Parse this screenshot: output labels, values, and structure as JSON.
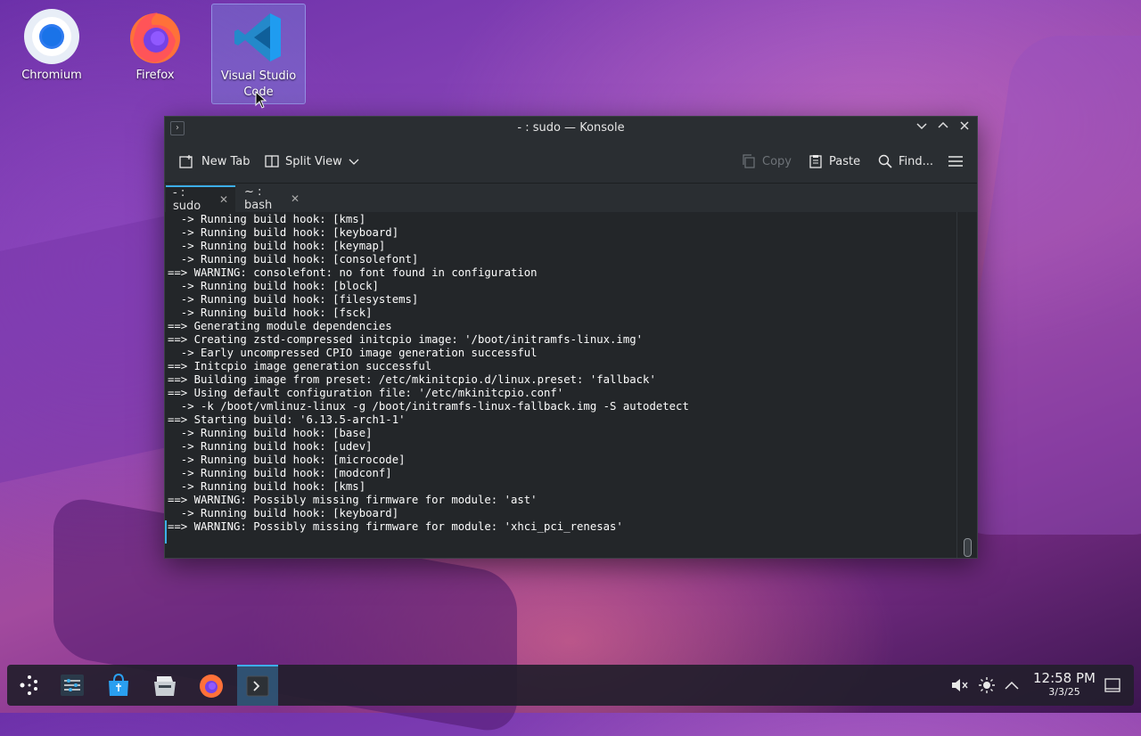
{
  "desktop": {
    "icons": [
      {
        "label": "Chromium"
      },
      {
        "label": "Firefox"
      },
      {
        "label": "Visual Studio Code"
      }
    ]
  },
  "window": {
    "title": "- : sudo — Konsole",
    "toolbar": {
      "new_tab": "New Tab",
      "split_view": "Split View",
      "copy": "Copy",
      "paste": "Paste",
      "find": "Find..."
    },
    "tabs": [
      {
        "label": "- : sudo",
        "active": true
      },
      {
        "label": "~ : bash",
        "active": false
      }
    ],
    "terminal_lines": [
      "  -> Running build hook: [kms]",
      "  -> Running build hook: [keyboard]",
      "  -> Running build hook: [keymap]",
      "  -> Running build hook: [consolefont]",
      "==> WARNING: consolefont: no font found in configuration",
      "  -> Running build hook: [block]",
      "  -> Running build hook: [filesystems]",
      "  -> Running build hook: [fsck]",
      "==> Generating module dependencies",
      "==> Creating zstd-compressed initcpio image: '/boot/initramfs-linux.img'",
      "  -> Early uncompressed CPIO image generation successful",
      "==> Initcpio image generation successful",
      "==> Building image from preset: /etc/mkinitcpio.d/linux.preset: 'fallback'",
      "==> Using default configuration file: '/etc/mkinitcpio.conf'",
      "  -> -k /boot/vmlinuz-linux -g /boot/initramfs-linux-fallback.img -S autodetect",
      "==> Starting build: '6.13.5-arch1-1'",
      "  -> Running build hook: [base]",
      "  -> Running build hook: [udev]",
      "  -> Running build hook: [microcode]",
      "  -> Running build hook: [modconf]",
      "  -> Running build hook: [kms]",
      "==> WARNING: Possibly missing firmware for module: 'ast'",
      "  -> Running build hook: [keyboard]",
      "==> WARNING: Possibly missing firmware for module: 'xhci_pci_renesas'"
    ]
  },
  "taskbar": {
    "clock_time": "12:58 PM",
    "clock_date": "3/3/25"
  },
  "colors": {
    "accent": "#3daee9",
    "terminal_bg": "#232629",
    "terminal_fg": "#fcfcfc"
  }
}
